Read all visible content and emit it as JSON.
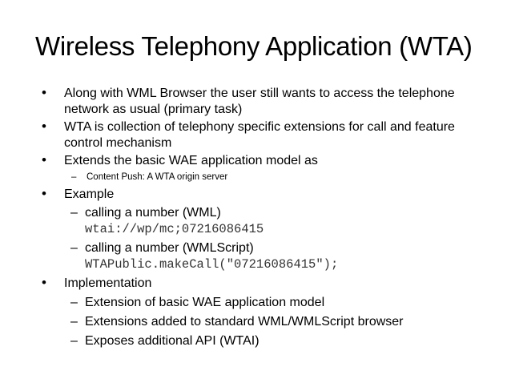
{
  "slide": {
    "title": "Wireless Telephony Application (WTA)",
    "bullets": [
      {
        "lines": [
          "Along with WML Browser the user still wants to access the telephone",
          "network as usual (primary task)"
        ]
      },
      {
        "lines": [
          "WTA is collection of telephony specific extensions for call and feature",
          "control mechanism"
        ]
      },
      {
        "lines": [
          "Extends the basic WAE application model as"
        ],
        "sub": [
          "Content Push: A WTA origin server"
        ]
      },
      {
        "lines": [
          "Example"
        ],
        "sub": [
          {
            "label": "calling a number (WML)",
            "code": "wtai://wp/mc;07216086415"
          },
          {
            "label": "calling a number (WMLScript)",
            "code": "WTAPublic.makeCall(\"07216086415\");"
          }
        ]
      },
      {
        "lines": [
          "Implementation"
        ],
        "sub": [
          "Extension of basic WAE application model",
          "Extensions added to standard WML/WMLScript browser",
          "Exposes additional API (WTAI)"
        ]
      }
    ]
  }
}
